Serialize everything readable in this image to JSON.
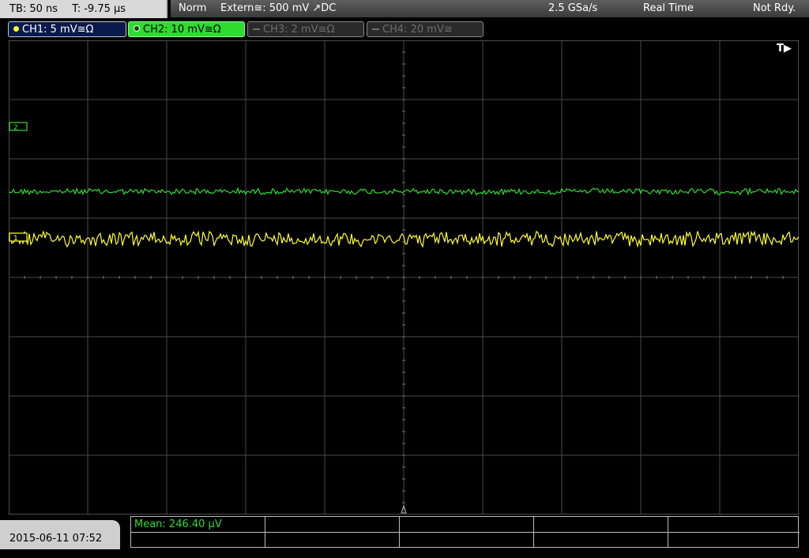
{
  "header": {
    "timebase": "TB: 50 ns",
    "trigger_time": "T: -9.75 µs",
    "mode": "Norm",
    "trigger_source": "Extern≅: 500 mV ↗DC",
    "sample_rate": "2.5 GSa/s",
    "acq_mode": "Real Time",
    "status": "Not Rdy."
  },
  "channels": [
    {
      "label": "CH1: 5 mV≅Ω",
      "state": "active-unselected",
      "color": "#ffff33"
    },
    {
      "label": "CH2: 10 mV≅Ω",
      "state": "selected",
      "color": "#2fdb2f"
    },
    {
      "label": "CH3: 2 mV≅Ω",
      "state": "off",
      "color": "#6d6d6d"
    },
    {
      "label": "CH4: 20 mV≅",
      "state": "off",
      "color": "#6d6d6d"
    }
  ],
  "screen": {
    "trigger_marker": "T▶",
    "ch2_marker": "2",
    "ch1_marker": "1"
  },
  "footer": {
    "datetime": "2015-06-11 07:52",
    "measurement": "Mean: 246.40 µV"
  },
  "chart_data": {
    "type": "line",
    "grid": true,
    "divisions_x": 10,
    "divisions_y": 8,
    "series": [
      {
        "name": "CH2",
        "color": "#2fdb2f",
        "level_div": 1.45,
        "noise_div": 0.05
      },
      {
        "name": "CH1",
        "color": "#ffff33",
        "level_div": 0.65,
        "noise_div": 0.12
      }
    ]
  }
}
